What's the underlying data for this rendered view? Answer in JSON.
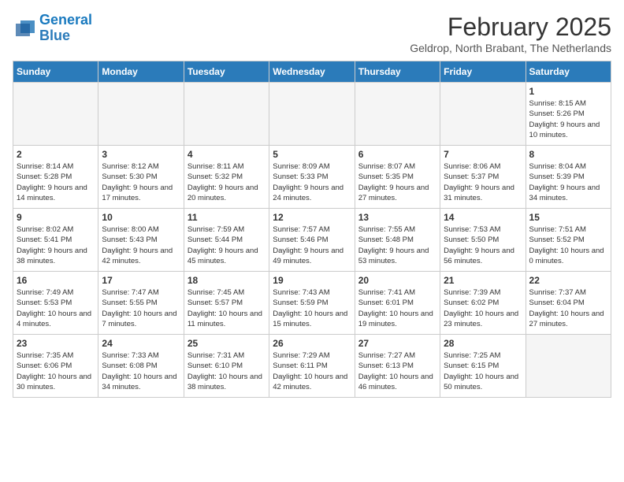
{
  "logo": {
    "line1": "General",
    "line2": "Blue"
  },
  "title": "February 2025",
  "subtitle": "Geldrop, North Brabant, The Netherlands",
  "days_header": [
    "Sunday",
    "Monday",
    "Tuesday",
    "Wednesday",
    "Thursday",
    "Friday",
    "Saturday"
  ],
  "weeks": [
    [
      {
        "day": "",
        "info": ""
      },
      {
        "day": "",
        "info": ""
      },
      {
        "day": "",
        "info": ""
      },
      {
        "day": "",
        "info": ""
      },
      {
        "day": "",
        "info": ""
      },
      {
        "day": "",
        "info": ""
      },
      {
        "day": "1",
        "info": "Sunrise: 8:15 AM\nSunset: 5:26 PM\nDaylight: 9 hours and 10 minutes."
      }
    ],
    [
      {
        "day": "2",
        "info": "Sunrise: 8:14 AM\nSunset: 5:28 PM\nDaylight: 9 hours and 14 minutes."
      },
      {
        "day": "3",
        "info": "Sunrise: 8:12 AM\nSunset: 5:30 PM\nDaylight: 9 hours and 17 minutes."
      },
      {
        "day": "4",
        "info": "Sunrise: 8:11 AM\nSunset: 5:32 PM\nDaylight: 9 hours and 20 minutes."
      },
      {
        "day": "5",
        "info": "Sunrise: 8:09 AM\nSunset: 5:33 PM\nDaylight: 9 hours and 24 minutes."
      },
      {
        "day": "6",
        "info": "Sunrise: 8:07 AM\nSunset: 5:35 PM\nDaylight: 9 hours and 27 minutes."
      },
      {
        "day": "7",
        "info": "Sunrise: 8:06 AM\nSunset: 5:37 PM\nDaylight: 9 hours and 31 minutes."
      },
      {
        "day": "8",
        "info": "Sunrise: 8:04 AM\nSunset: 5:39 PM\nDaylight: 9 hours and 34 minutes."
      }
    ],
    [
      {
        "day": "9",
        "info": "Sunrise: 8:02 AM\nSunset: 5:41 PM\nDaylight: 9 hours and 38 minutes."
      },
      {
        "day": "10",
        "info": "Sunrise: 8:00 AM\nSunset: 5:43 PM\nDaylight: 9 hours and 42 minutes."
      },
      {
        "day": "11",
        "info": "Sunrise: 7:59 AM\nSunset: 5:44 PM\nDaylight: 9 hours and 45 minutes."
      },
      {
        "day": "12",
        "info": "Sunrise: 7:57 AM\nSunset: 5:46 PM\nDaylight: 9 hours and 49 minutes."
      },
      {
        "day": "13",
        "info": "Sunrise: 7:55 AM\nSunset: 5:48 PM\nDaylight: 9 hours and 53 minutes."
      },
      {
        "day": "14",
        "info": "Sunrise: 7:53 AM\nSunset: 5:50 PM\nDaylight: 9 hours and 56 minutes."
      },
      {
        "day": "15",
        "info": "Sunrise: 7:51 AM\nSunset: 5:52 PM\nDaylight: 10 hours and 0 minutes."
      }
    ],
    [
      {
        "day": "16",
        "info": "Sunrise: 7:49 AM\nSunset: 5:53 PM\nDaylight: 10 hours and 4 minutes."
      },
      {
        "day": "17",
        "info": "Sunrise: 7:47 AM\nSunset: 5:55 PM\nDaylight: 10 hours and 7 minutes."
      },
      {
        "day": "18",
        "info": "Sunrise: 7:45 AM\nSunset: 5:57 PM\nDaylight: 10 hours and 11 minutes."
      },
      {
        "day": "19",
        "info": "Sunrise: 7:43 AM\nSunset: 5:59 PM\nDaylight: 10 hours and 15 minutes."
      },
      {
        "day": "20",
        "info": "Sunrise: 7:41 AM\nSunset: 6:01 PM\nDaylight: 10 hours and 19 minutes."
      },
      {
        "day": "21",
        "info": "Sunrise: 7:39 AM\nSunset: 6:02 PM\nDaylight: 10 hours and 23 minutes."
      },
      {
        "day": "22",
        "info": "Sunrise: 7:37 AM\nSunset: 6:04 PM\nDaylight: 10 hours and 27 minutes."
      }
    ],
    [
      {
        "day": "23",
        "info": "Sunrise: 7:35 AM\nSunset: 6:06 PM\nDaylight: 10 hours and 30 minutes."
      },
      {
        "day": "24",
        "info": "Sunrise: 7:33 AM\nSunset: 6:08 PM\nDaylight: 10 hours and 34 minutes."
      },
      {
        "day": "25",
        "info": "Sunrise: 7:31 AM\nSunset: 6:10 PM\nDaylight: 10 hours and 38 minutes."
      },
      {
        "day": "26",
        "info": "Sunrise: 7:29 AM\nSunset: 6:11 PM\nDaylight: 10 hours and 42 minutes."
      },
      {
        "day": "27",
        "info": "Sunrise: 7:27 AM\nSunset: 6:13 PM\nDaylight: 10 hours and 46 minutes."
      },
      {
        "day": "28",
        "info": "Sunrise: 7:25 AM\nSunset: 6:15 PM\nDaylight: 10 hours and 50 minutes."
      },
      {
        "day": "",
        "info": ""
      }
    ]
  ]
}
